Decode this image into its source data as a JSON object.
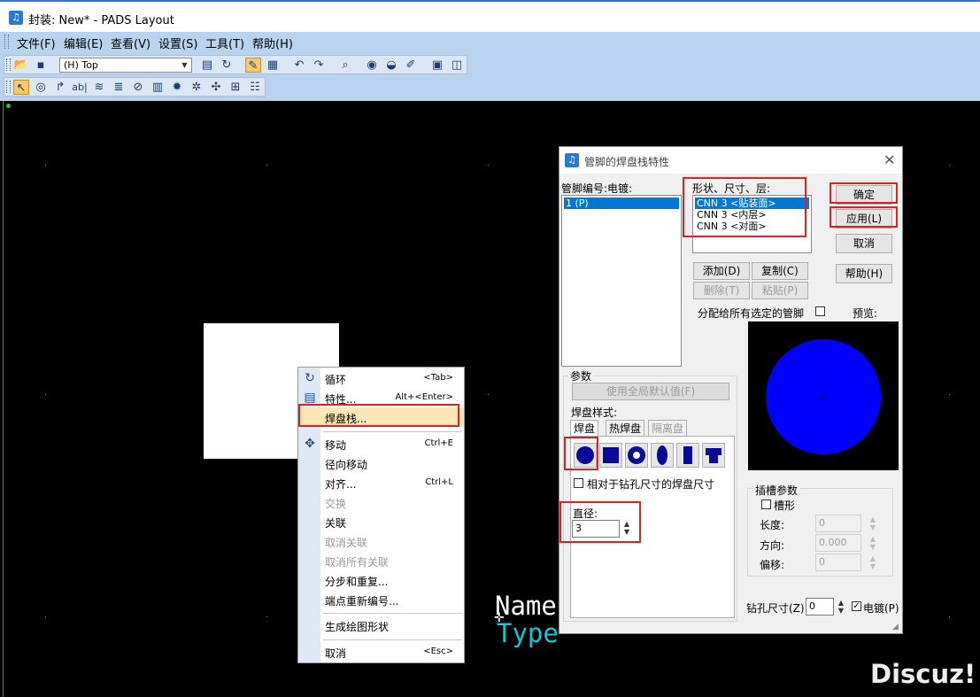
{
  "window": {
    "title": "封装: New* - PADS Layout"
  },
  "menu": [
    "文件(F)",
    "编辑(E)",
    "查看(V)",
    "设置(S)",
    "工具(T)",
    "帮助(H)"
  ],
  "toolbar": {
    "layer_select": "(H) Top"
  },
  "canvas": {
    "labels": {
      "name": "Name",
      "type": "Type"
    }
  },
  "context_menu": {
    "items": [
      {
        "label": "循环",
        "shortcut": "<Tab>"
      },
      {
        "label": "特性...",
        "shortcut": "Alt+<Enter>"
      },
      {
        "label": "焊盘栈...",
        "shortcut": ""
      },
      {
        "label": "移动",
        "shortcut": "Ctrl+E"
      },
      {
        "label": "径向移动",
        "shortcut": ""
      },
      {
        "label": "对齐...",
        "shortcut": "Ctrl+L"
      },
      {
        "label": "交换",
        "shortcut": ""
      },
      {
        "label": "关联",
        "shortcut": ""
      },
      {
        "label": "取消关联",
        "shortcut": ""
      },
      {
        "label": "取消所有关联",
        "shortcut": ""
      },
      {
        "label": "分步和重复...",
        "shortcut": ""
      },
      {
        "label": "端点重新编号...",
        "shortcut": ""
      },
      {
        "label": "生成绘图形状",
        "shortcut": ""
      },
      {
        "label": "取消",
        "shortcut": "<Esc>"
      }
    ]
  },
  "dialog": {
    "title": "管脚的焊盘栈特性",
    "pin_list_label": "管脚编号:电镀:",
    "pins": [
      "1 (P)"
    ],
    "shape_list_label": "形状、尺寸、层:",
    "shapes": [
      "CNN 3 <贴装面>",
      "CNN 3 <内层>",
      "CNN 3 <对面>"
    ],
    "buttons": {
      "ok": "确定",
      "apply": "应用(L)",
      "cancel": "取消",
      "help": "帮助(H)",
      "add": "添加(D)",
      "copy": "复制(C)",
      "delete": "删除(T)",
      "paste": "粘贴(P)",
      "use_global": "使用全局默认值(F)"
    },
    "assign_all_label": "分配给所有选定的管脚",
    "preview_label": "预览:",
    "params_label": "参数",
    "pad_style_label": "焊盘样式:",
    "tabs": [
      "焊盘",
      "热焊盘",
      "隔离盘"
    ],
    "relative_drill_label": "相对于钻孔尺寸的焊盘尺寸",
    "diameter_label": "直径:",
    "diameter_value": "3",
    "slot": {
      "group_label": "插槽参数",
      "slotted_label": "槽形",
      "length_label": "长度:",
      "length_value": "0",
      "orientation_label": "方向:",
      "orientation_value": "0.000",
      "offset_label": "偏移:",
      "offset_value": "0"
    },
    "drill_label": "钻孔尺寸(Z):",
    "drill_value": "0",
    "plated_label": "电镀(P)",
    "colors": {
      "preview_pad": "#0000ff",
      "highlight": "#e02020"
    }
  },
  "watermark": "Discuz!"
}
